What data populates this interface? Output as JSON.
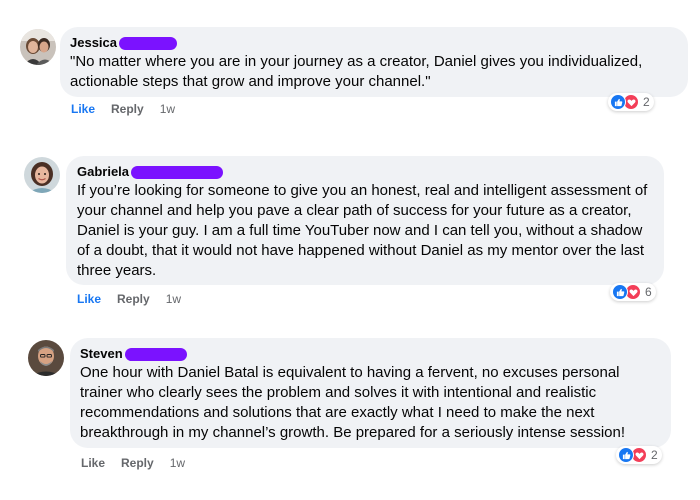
{
  "comments": [
    {
      "author": "Jessica",
      "text": "\"No matter where you are in your journey as a creator, Daniel gives you individualized, actionable steps that grow and improve your channel.\"",
      "like_label": "Like",
      "reply_label": "Reply",
      "time": "1w",
      "reaction_count": "2"
    },
    {
      "author": "Gabriela",
      "text": "If you’re looking for someone to give you an honest, real and intelligent assessment of your channel and help you pave a clear path of success for your future as a creator, Daniel is your guy. I am a full time YouTuber now and I can tell you, without a shadow of a doubt, that it would not have happened without Daniel as my mentor over the last three years.",
      "like_label": "Like",
      "reply_label": "Reply",
      "time": "1w",
      "reaction_count": "6"
    },
    {
      "author": "Steven",
      "text": "One hour with Daniel Batal is equivalent to having a fervent, no excuses personal trainer who clearly sees the problem and solves it with intentional and realistic recommendations and solutions that are exactly what I need to make the next breakthrough in my channel’s growth. Be prepared for a seriously intense session!",
      "like_label": "Like",
      "reply_label": "Reply",
      "time": "1w",
      "reaction_count": "2"
    }
  ],
  "colors": {
    "bubble": "#f0f2f5",
    "redaction": "#7b12ff",
    "like_blue": "#1877f2",
    "love_red": "#f33e58",
    "meta_gray": "#65676b"
  },
  "icons": {
    "like_reaction": "thumbs-up-icon",
    "love_reaction": "heart-icon"
  }
}
